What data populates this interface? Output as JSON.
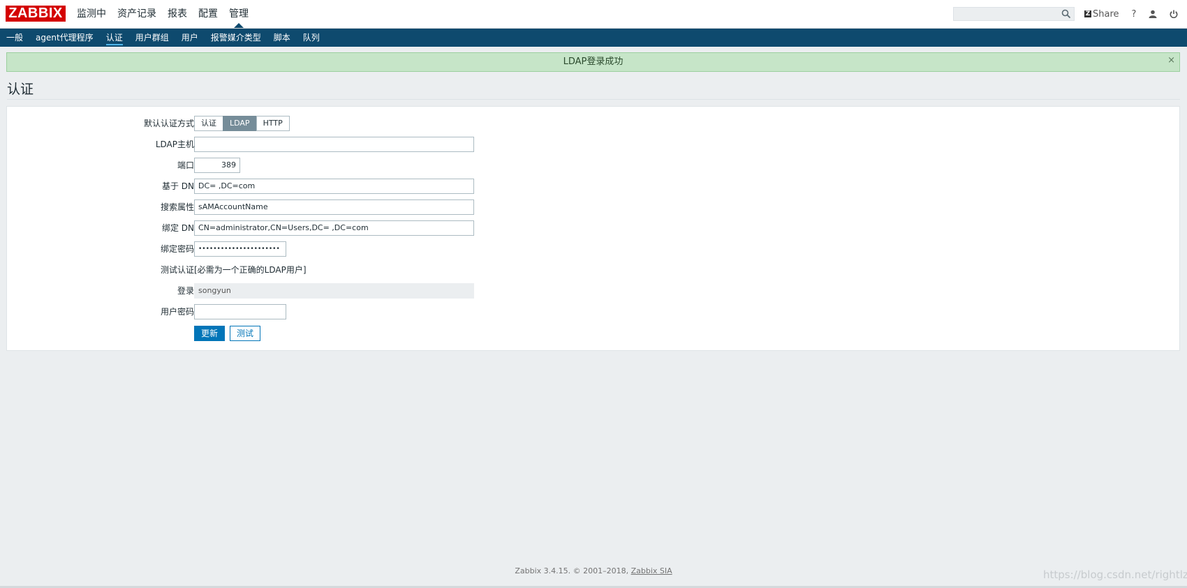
{
  "header": {
    "logo": "ZABBIX",
    "nav": [
      "监测中",
      "资产记录",
      "报表",
      "配置",
      "管理"
    ],
    "active_nav": "管理",
    "search": {
      "value": "",
      "placeholder": ""
    },
    "share_label": "Share",
    "help_label": "?"
  },
  "subnav": {
    "items": [
      "一般",
      "agent代理程序",
      "认证",
      "用户群组",
      "用户",
      "报警媒介类型",
      "脚本",
      "队列"
    ],
    "active": "认证"
  },
  "message": {
    "text": "LDAP登录成功",
    "close": "×"
  },
  "page": {
    "title": "认证"
  },
  "form": {
    "default_auth": {
      "label": "默认认证方式",
      "options": [
        "认证",
        "LDAP",
        "HTTP"
      ],
      "selected": "LDAP"
    },
    "ldap_host": {
      "label": "LDAP主机",
      "value": ""
    },
    "port": {
      "label": "端口",
      "value": "389"
    },
    "base_dn": {
      "label": "基于 DN",
      "value": "DC=        ,DC=com"
    },
    "search_attr": {
      "label": "搜索属性",
      "value": "sAMAccountName"
    },
    "bind_dn": {
      "label": "绑定 DN",
      "value": "CN=administrator,CN=Users,DC=         ,DC=com"
    },
    "bind_password": {
      "label": "绑定密码",
      "value": "••••••••••••••••••••••"
    },
    "test_auth": {
      "label": "测试认证",
      "value": "[必需为一个正确的LDAP用户]"
    },
    "login": {
      "label": "登录",
      "value": "songyun"
    },
    "user_password": {
      "label": "用户密码",
      "value": ""
    },
    "update_button": "更新",
    "test_button": "测试"
  },
  "footer": {
    "text": "Zabbix 3.4.15. © 2001–2018,",
    "link": "Zabbix SIA"
  },
  "watermark": "https://blog.csdn.net/rightlzc",
  "colors": {
    "brand": "#d40000",
    "subnav": "#0e4a6e",
    "primary": "#0275b8",
    "success_bg": "#c6e5c8"
  }
}
